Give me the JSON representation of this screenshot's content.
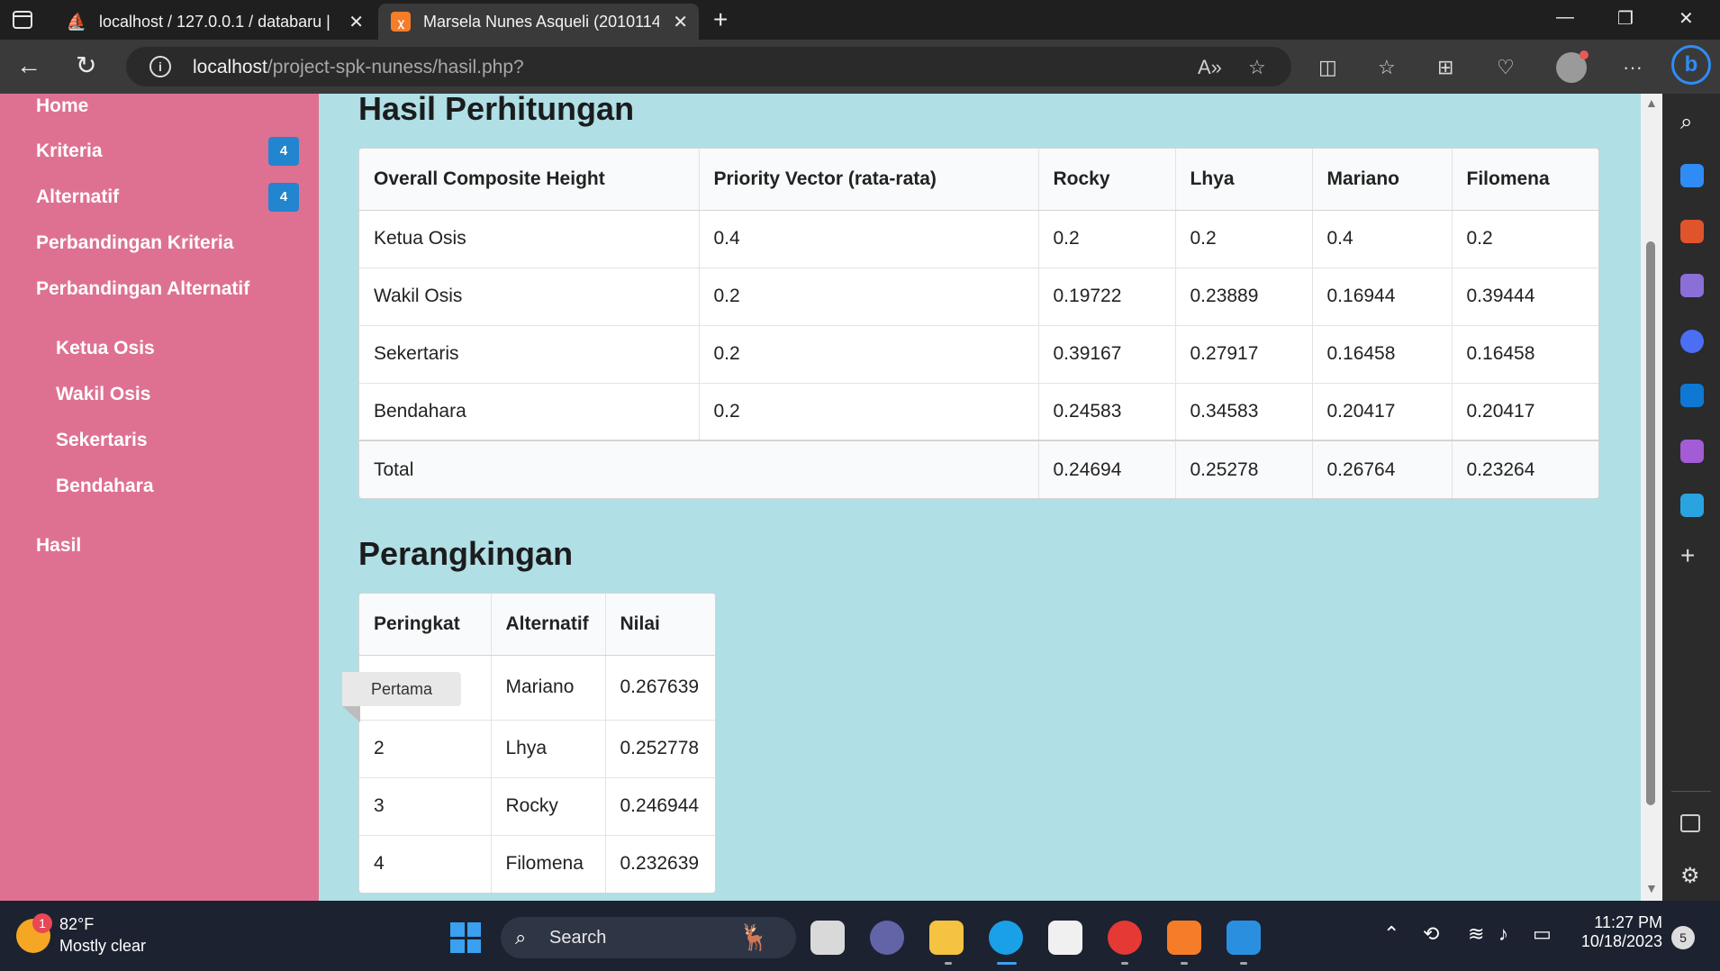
{
  "browser": {
    "tabs": [
      {
        "title": "localhost / 127.0.0.1 / databaru |",
        "icon": "phpmyadmin-icon"
      },
      {
        "title": "Marsela Nunes Asqueli (2010114",
        "icon": "xampp-icon"
      }
    ],
    "url_host": "localhost",
    "url_path": "/project-spk-nuness/hasil.php?"
  },
  "sidebar": {
    "items": [
      {
        "label": "Home"
      },
      {
        "label": "Kriteria",
        "badge": "4"
      },
      {
        "label": "Alternatif",
        "badge": "4"
      },
      {
        "label": "Perbandingan Kriteria"
      },
      {
        "label": "Perbandingan Alternatif"
      }
    ],
    "sub_items": [
      {
        "label": "Ketua Osis"
      },
      {
        "label": "Wakil Osis"
      },
      {
        "label": "Sekertaris"
      },
      {
        "label": "Bendahara"
      }
    ],
    "result_item": "Hasil"
  },
  "hasil": {
    "heading": "Hasil Perhitungan",
    "headers": [
      "Overall Composite Height",
      "Priority Vector (rata-rata)",
      "Rocky",
      "Lhya",
      "Mariano",
      "Filomena"
    ],
    "rows": [
      [
        "Ketua Osis",
        "0.4",
        "0.2",
        "0.2",
        "0.4",
        "0.2"
      ],
      [
        "Wakil Osis",
        "0.2",
        "0.19722",
        "0.23889",
        "0.16944",
        "0.39444"
      ],
      [
        "Sekertaris",
        "0.2",
        "0.39167",
        "0.27917",
        "0.16458",
        "0.16458"
      ],
      [
        "Bendahara",
        "0.2",
        "0.24583",
        "0.34583",
        "0.20417",
        "0.20417"
      ]
    ],
    "total": {
      "label": "Total",
      "values": [
        "0.24694",
        "0.25278",
        "0.26764",
        "0.23264"
      ]
    }
  },
  "ranking": {
    "heading": "Perangkingan",
    "headers": [
      "Peringkat",
      "Alternatif",
      "Nilai"
    ],
    "rows": [
      [
        "Pertama",
        "Mariano",
        "0.267639"
      ],
      [
        "2",
        "Lhya",
        "0.252778"
      ],
      [
        "3",
        "Rocky",
        "0.246944"
      ],
      [
        "4",
        "Filomena",
        "0.232639"
      ]
    ]
  },
  "taskbar": {
    "weather_temp": "82°F",
    "weather_cond": "Mostly clear",
    "weather_badge": "1",
    "search_label": "Search",
    "time": "11:27 PM",
    "date": "10/18/2023",
    "notifications": "5"
  }
}
